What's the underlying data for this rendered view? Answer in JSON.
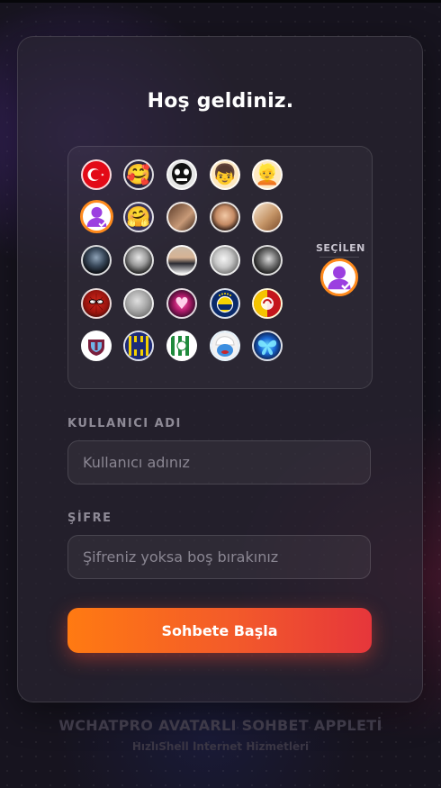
{
  "welcome_title": "Hoş geldiniz.",
  "avatars": [
    {
      "name": "turkish-flag",
      "icon": "turkish-flag-icon",
      "label": "☾"
    },
    {
      "name": "heart-eyes-emoji",
      "icon": "smiling-face-with-hearts-icon",
      "label": "🥰"
    },
    {
      "name": "skull-face",
      "icon": "skull-icon",
      "label": ""
    },
    {
      "name": "boy-emoji",
      "icon": "boy-face-icon",
      "label": "👦"
    },
    {
      "name": "girl-emoji",
      "icon": "blonde-girl-face-icon",
      "label": "👱"
    },
    {
      "name": "default-avatar",
      "icon": "user-check-icon",
      "label": ""
    },
    {
      "name": "hugging-emoji",
      "icon": "hugging-face-icon",
      "label": "🤗"
    },
    {
      "name": "man-photo",
      "icon": "person-photo-icon",
      "label": ""
    },
    {
      "name": "baby-photo",
      "icon": "baby-photo-icon",
      "label": ""
    },
    {
      "name": "hand-photo",
      "icon": "hand-photo-icon",
      "label": ""
    },
    {
      "name": "dark-portrait",
      "icon": "dark-portrait-icon",
      "label": ""
    },
    {
      "name": "bw-portrait-man",
      "icon": "bw-portrait-icon",
      "label": ""
    },
    {
      "name": "suit-man-photo",
      "icon": "suited-man-icon",
      "label": ""
    },
    {
      "name": "bw-woman-photo",
      "icon": "bw-woman-icon",
      "label": ""
    },
    {
      "name": "woman-smoke-photo",
      "icon": "woman-portrait-icon",
      "label": ""
    },
    {
      "name": "spiderman",
      "icon": "spiderman-icon",
      "label": ""
    },
    {
      "name": "grey-photo",
      "icon": "grey-photo-icon",
      "label": ""
    },
    {
      "name": "pink-heart",
      "icon": "pink-heart-icon",
      "label": "♥"
    },
    {
      "name": "fenerbahce",
      "icon": "fenerbahce-logo-icon",
      "label": ""
    },
    {
      "name": "galatasaray",
      "icon": "galatasaray-logo-icon",
      "label": ""
    },
    {
      "name": "trabzonspor",
      "icon": "trabzonspor-logo-icon",
      "label": ""
    },
    {
      "name": "ankaragucu",
      "icon": "ankaragucu-logo-icon",
      "label": ""
    },
    {
      "name": "bursaspor",
      "icon": "bursaspor-logo-icon",
      "label": ""
    },
    {
      "name": "smurf",
      "icon": "smurf-icon",
      "label": ""
    },
    {
      "name": "blue-butterfly",
      "icon": "butterfly-icon",
      "label": ""
    }
  ],
  "selected_label": "SEÇİLEN",
  "username": {
    "label": "KULLANICI ADI",
    "placeholder": "Kullanıcı adınız",
    "value": ""
  },
  "password": {
    "label": "ŞİFRE",
    "placeholder": "Şifreniz yoksa boş bırakınız",
    "value": ""
  },
  "submit_label": "Sohbete Başla",
  "footer": {
    "title": "WCHATPRO AVATARLI SOHBET APPLETİ",
    "subtitle": "HızlıShell Internet Hizmetleri"
  },
  "colors": {
    "accent_orange": "#ff8a1c",
    "button_start": "#ff7a12",
    "button_end": "#e6363b",
    "background": "#17141f",
    "card": "#28242f"
  }
}
